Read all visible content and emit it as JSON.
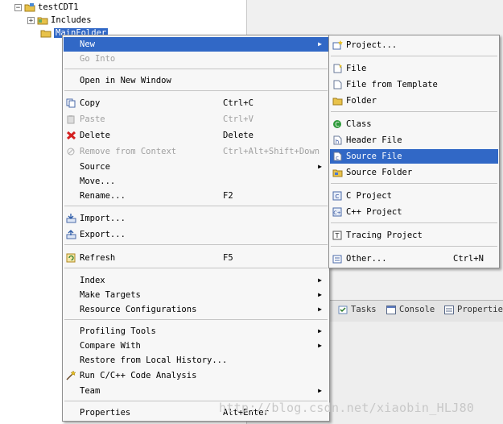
{
  "tree": {
    "project": "testCDT1",
    "includes": "Includes",
    "selected_folder": "MainFolder"
  },
  "context_menu": {
    "new": "New",
    "go_into": "Go Into",
    "open_new_window": "Open in New Window",
    "copy": "Copy",
    "copy_shortcut": "Ctrl+C",
    "paste": "Paste",
    "paste_shortcut": "Ctrl+V",
    "delete": "Delete",
    "delete_shortcut": "Delete",
    "remove_context": "Remove from Context",
    "remove_context_shortcut": "Ctrl+Alt+Shift+Down",
    "source": "Source",
    "move": "Move...",
    "rename": "Rename...",
    "rename_shortcut": "F2",
    "import": "Import...",
    "export": "Export...",
    "refresh": "Refresh",
    "refresh_shortcut": "F5",
    "index": "Index",
    "make_targets": "Make Targets",
    "resource_configurations": "Resource Configurations",
    "profiling_tools": "Profiling Tools",
    "compare_with": "Compare With",
    "restore_history": "Restore from Local History...",
    "run_analysis": "Run C/C++ Code Analysis",
    "team": "Team",
    "properties": "Properties",
    "properties_shortcut": "Alt+Enter"
  },
  "new_submenu": {
    "project": "Project...",
    "file": "File",
    "file_template": "File from Template",
    "folder": "Folder",
    "class": "Class",
    "header_file": "Header File",
    "source_file": "Source File",
    "source_folder": "Source Folder",
    "c_project": "C Project",
    "cpp_project": "C++ Project",
    "tracing_project": "Tracing Project",
    "other": "Other...",
    "other_shortcut": "Ctrl+N"
  },
  "views": {
    "tasks": "Tasks",
    "console": "Console",
    "properties": "Properties"
  },
  "watermark": "http://blog.csdn.net/xiaobin_HLJ80",
  "colors": {
    "highlight": "#3168c6",
    "menu_bg": "#f7f7f7"
  }
}
